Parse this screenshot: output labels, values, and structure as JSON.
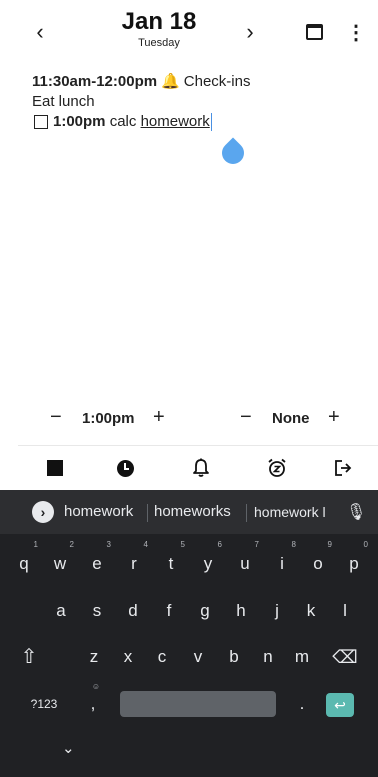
{
  "header": {
    "prev_label": "‹",
    "next_label": "›",
    "title": "Jan 18",
    "subtitle": "Tuesday",
    "menu_label": "⋮"
  },
  "notes": {
    "line1_time": "11:30am-12:00pm",
    "line1_text": "Check-ins",
    "line2_text": "Eat lunch",
    "line3_time": "1:00pm",
    "line3_text_plain": "calc",
    "line3_text_link": "homework"
  },
  "steppers": {
    "start_minus": "−",
    "start_value": "1:00pm",
    "start_plus": "+",
    "end_minus": "−",
    "end_value": "None",
    "end_plus": "+"
  },
  "toolbar": {
    "icons": [
      "stop-square-icon",
      "clock-icon",
      "bell-icon",
      "snooze-alarm-icon",
      "exit-icon"
    ]
  },
  "keyboard": {
    "suggestions": [
      "homework",
      "homeworks",
      "homework l"
    ],
    "row1": [
      {
        "k": "q",
        "h": "1"
      },
      {
        "k": "w",
        "h": "2"
      },
      {
        "k": "e",
        "h": "3"
      },
      {
        "k": "r",
        "h": "4"
      },
      {
        "k": "t",
        "h": "5"
      },
      {
        "k": "y",
        "h": "6"
      },
      {
        "k": "u",
        "h": "7"
      },
      {
        "k": "i",
        "h": "8"
      },
      {
        "k": "o",
        "h": "9"
      },
      {
        "k": "p",
        "h": "0"
      }
    ],
    "row2": [
      "a",
      "s",
      "d",
      "f",
      "g",
      "h",
      "j",
      "k",
      "l"
    ],
    "row3": [
      "z",
      "x",
      "c",
      "v",
      "b",
      "n",
      "m"
    ],
    "symbols_label": "?123",
    "comma_label": ",",
    "period_label": "."
  },
  "colors": {
    "accent_cursor": "#4a90e2",
    "bell": "#f3b32a",
    "keyboard_bg": "#202124",
    "enter_key": "#5bb9b0"
  }
}
